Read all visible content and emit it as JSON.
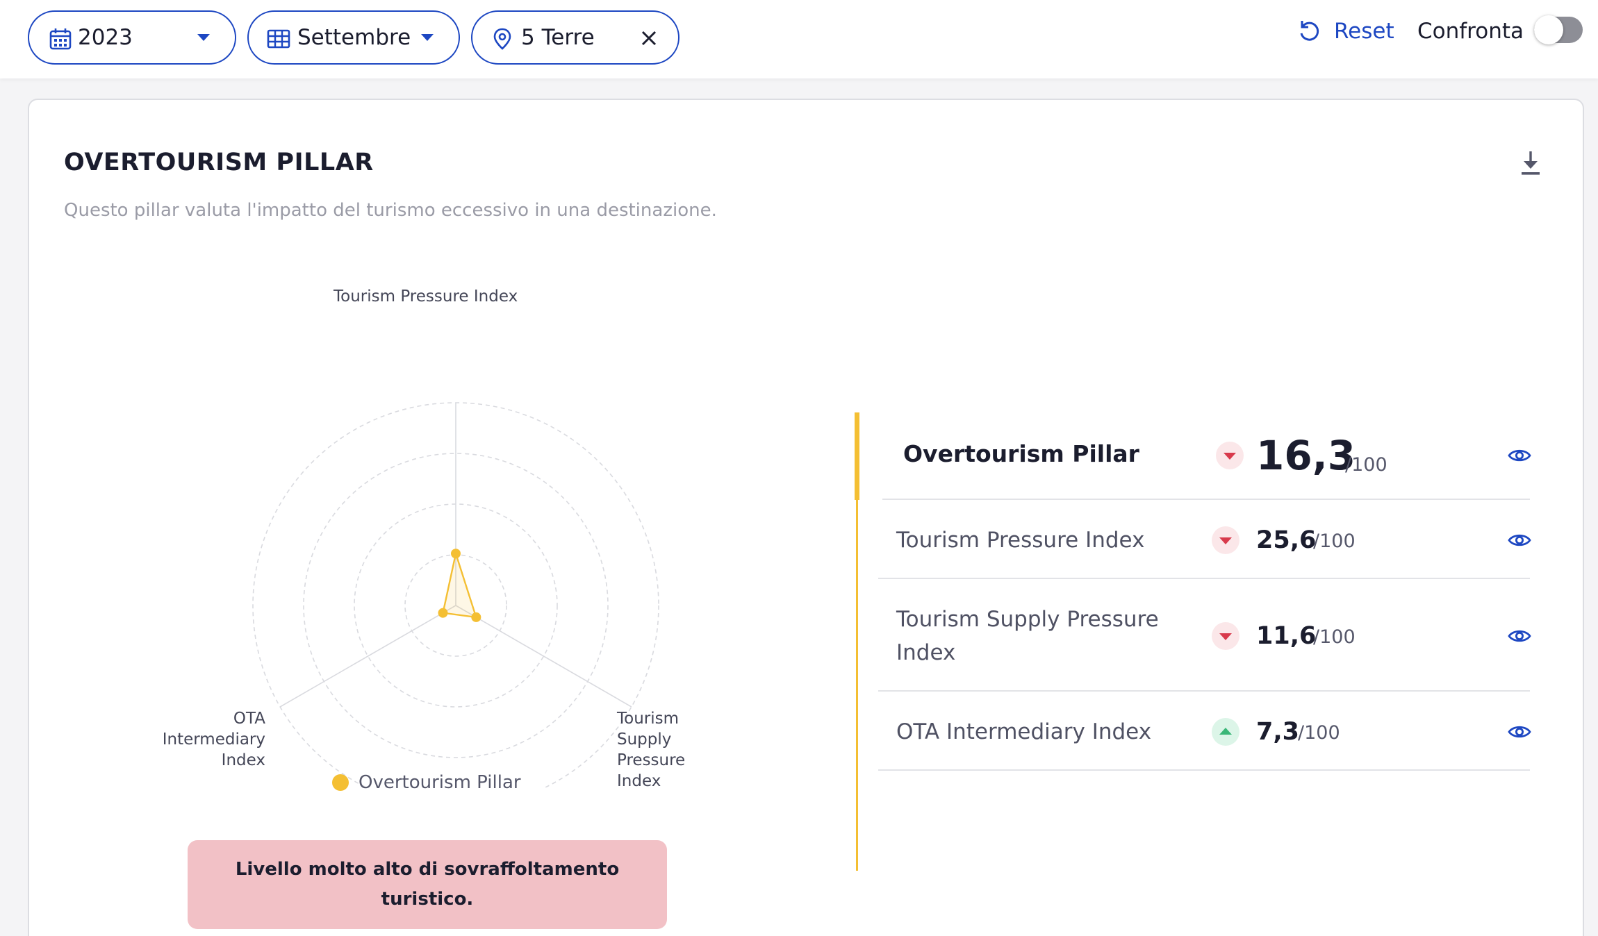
{
  "filters": {
    "year": "2023",
    "month": "Settembre",
    "location": "5 Terre"
  },
  "actions": {
    "reset_label": "Reset",
    "compare_label": "Confronta",
    "compare_enabled": false
  },
  "card": {
    "title": "OVERTOURISM PILLAR",
    "subtitle": "Questo pillar valuta l'impatto del turismo eccessivo in una destinazione."
  },
  "chart_data": {
    "type": "radar",
    "axes": [
      "Tourism Pressure Index",
      "Tourism Supply Pressure Index",
      "OTA Intermediary Index"
    ],
    "axis_labels": {
      "top": "Tourism Pressure Index",
      "right": [
        "Tourism",
        "Supply",
        "Pressure",
        "Index"
      ],
      "left": [
        "OTA",
        "Intermediary",
        "Index"
      ]
    },
    "series": [
      {
        "name": "Overtourism Pillar",
        "values": [
          25.6,
          11.6,
          7.3
        ],
        "color": "#f4bf33"
      }
    ],
    "rmax": 100,
    "rings": 4,
    "legend_position": "bottom"
  },
  "alert": {
    "line1": "Livello molto alto di sovraffoltamento",
    "line2": "turistico."
  },
  "scores": {
    "unit": "/100",
    "rows": [
      {
        "name": "Overtourism Pillar",
        "value": "16,3",
        "trend": "down"
      },
      {
        "name": "Tourism Pressure Index",
        "value": "25,6",
        "trend": "down"
      },
      {
        "name_line1": "Tourism Supply Pressure",
        "name_line2": "Index",
        "value": "11,6",
        "trend": "down"
      },
      {
        "name": "OTA Intermediary Index",
        "value": "7,3",
        "trend": "up"
      }
    ]
  },
  "colors": {
    "accent_blue": "#1d47c2",
    "pillar_yellow": "#f4bf33",
    "trend_down": "#d83a4c",
    "trend_up": "#3ab778",
    "alert_bg": "#f2c1c6"
  }
}
